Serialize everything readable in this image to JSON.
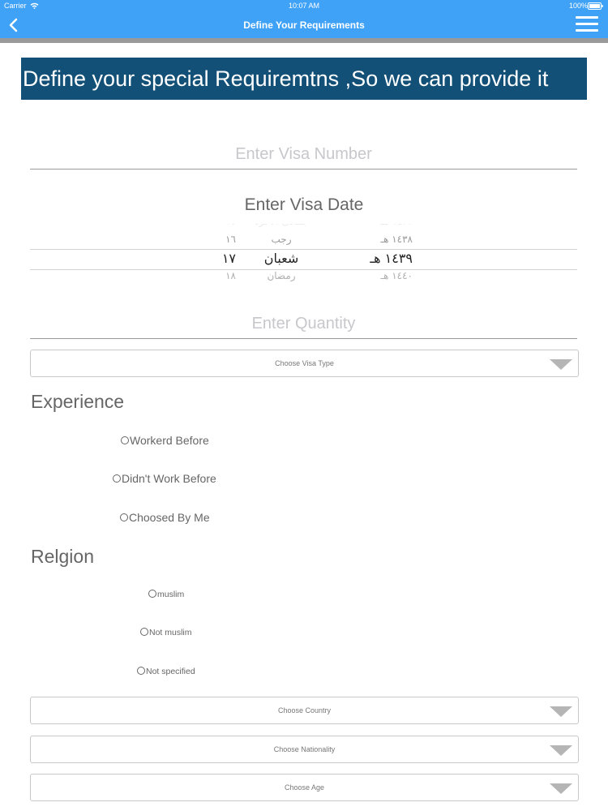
{
  "status_bar": {
    "carrier": "Carrier",
    "time": "10:07 AM",
    "battery": "100%"
  },
  "nav": {
    "title": "Define Your Requirements",
    "back_icon": "chevron-left-icon",
    "menu_icon": "hamburger-menu-icon"
  },
  "banner": {
    "text": "Define your special Requiremtns ,So we can provide it"
  },
  "form": {
    "visa_number_placeholder": "Enter Visa Number",
    "visa_date_label": "Enter Visa Date",
    "quantity_placeholder": "Enter Quantity",
    "visa_type_label": "Choose Visa Type"
  },
  "date_picker": {
    "rows": [
      {
        "day": "١٦",
        "month": "رجب",
        "year": "١٤٣٨ هـ"
      },
      {
        "day": "١٧",
        "month": "شعبان",
        "year": "١٤٣٩ هـ"
      },
      {
        "day": "١٨",
        "month": "رمضان",
        "year": "١٤٤٠ هـ"
      }
    ],
    "selected_index": 1
  },
  "experience": {
    "title": "Experience",
    "options": [
      "Workerd Before",
      "Didn't Work Before",
      "Choosed By Me"
    ]
  },
  "religion": {
    "title": "Relgion",
    "options": [
      "muslim",
      "Not muslim",
      "Not specified"
    ]
  },
  "dropdowns": {
    "country": "Choose Country",
    "nationality": "Choose Nationality",
    "age": "Choose Age"
  },
  "colors": {
    "nav_bg": "#3fa2f7",
    "banner_bg": "#135077",
    "nav_shadow": "#9a9a9a"
  }
}
